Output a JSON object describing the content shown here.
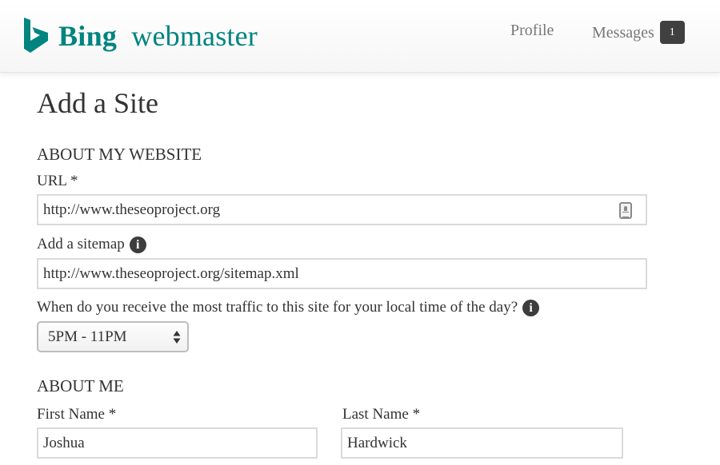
{
  "header": {
    "logo_primary": "Bing",
    "logo_secondary": "webmaster",
    "brand_color": "#00847f",
    "nav": {
      "profile_label": "Profile",
      "messages_label": "Messages",
      "messages_count": "1"
    }
  },
  "page": {
    "title": "Add a Site"
  },
  "about_website": {
    "heading": "ABOUT MY WEBSITE",
    "url": {
      "label": "URL *",
      "value": "http://www.theseoproject.org",
      "trailing_icon": "contact-card-icon"
    },
    "sitemap": {
      "label": "Add a sitemap",
      "info_icon": "info-icon",
      "value": "http://www.theseoproject.org/sitemap.xml"
    },
    "traffic_time": {
      "label": "When do you receive the most traffic to this site for your local time of the day?",
      "info_icon": "info-icon",
      "selected": "5PM - 11PM"
    }
  },
  "about_me": {
    "heading": "ABOUT ME",
    "first_name": {
      "label": "First Name *",
      "value": "Joshua"
    },
    "last_name": {
      "label": "Last Name *",
      "value": "Hardwick"
    }
  }
}
